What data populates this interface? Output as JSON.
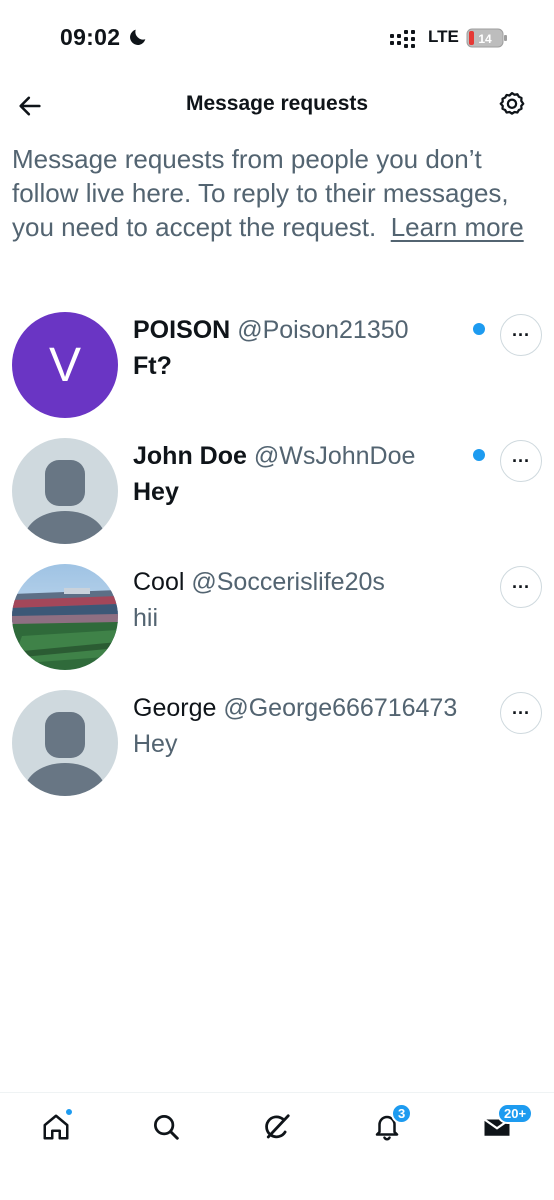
{
  "status_bar": {
    "time": "09:02",
    "network": "LTE",
    "battery": "14"
  },
  "header": {
    "title": "Message requests"
  },
  "intro": {
    "text": "Message requests from people you don’t follow live here. To reply to their messages, you need to accept the request.",
    "link": "Learn more"
  },
  "requests": [
    {
      "name": "POISON",
      "handle": "@Poison21350",
      "message": "Ft?",
      "unread": true,
      "avatar_letter": "V"
    },
    {
      "name": "John Doe",
      "handle": "@WsJohnDoe",
      "message": "Hey",
      "unread": true
    },
    {
      "name": "Cool",
      "handle": "@Soccerislife20s",
      "message": "hii",
      "unread": false
    },
    {
      "name": "George",
      "handle": "@George666716473",
      "message": "Hey",
      "unread": false
    }
  ],
  "more_glyph": "···",
  "bottom_nav": {
    "notifications_badge": "3",
    "messages_badge": "20+"
  },
  "colors": {
    "accent": "#1d9bf0",
    "avatar_purple": "#6a35c4",
    "muted_text": "#536471",
    "default_avatar_bg": "#cfd9de",
    "default_avatar_fg": "#687684"
  }
}
